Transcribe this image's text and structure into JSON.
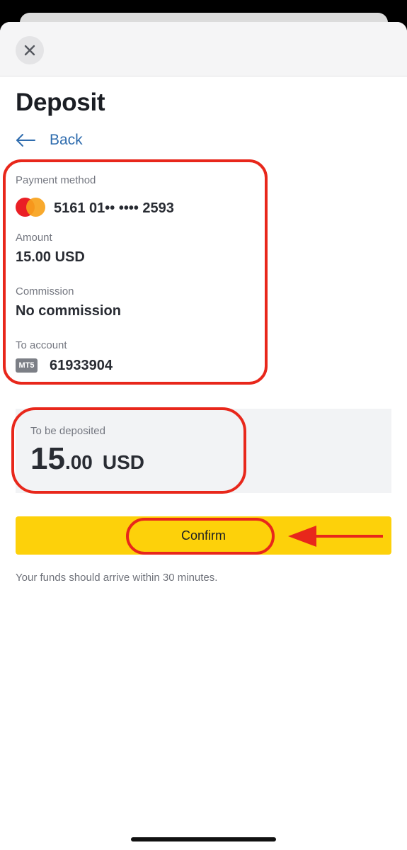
{
  "header": {
    "title": "Deposit",
    "back_label": "Back"
  },
  "details": {
    "payment_method_label": "Payment method",
    "payment_method_value": "5161 01•• •••• 2593",
    "amount_label": "Amount",
    "amount_value": "15.00 USD",
    "commission_label": "Commission",
    "commission_value": "No commission",
    "account_label": "To account",
    "account_badge": "MT5",
    "account_value": "61933904"
  },
  "summary": {
    "label": "To be deposited",
    "amount_whole": "15",
    "amount_fraction": ".00",
    "currency": "USD"
  },
  "actions": {
    "confirm_label": "Confirm"
  },
  "note": "Your funds should arrive within 30 minutes.",
  "colors": {
    "accent_yellow": "#fdd10a",
    "link_blue": "#2f6cae",
    "highlight_red": "#e8271b",
    "mastercard_red": "#ea1f25",
    "mastercard_orange": "#f7a21b"
  },
  "icons": {
    "close": "close-icon",
    "back": "arrow-left-icon",
    "card": "mastercard-icon",
    "pointer": "arrow-left-annotation-icon"
  }
}
